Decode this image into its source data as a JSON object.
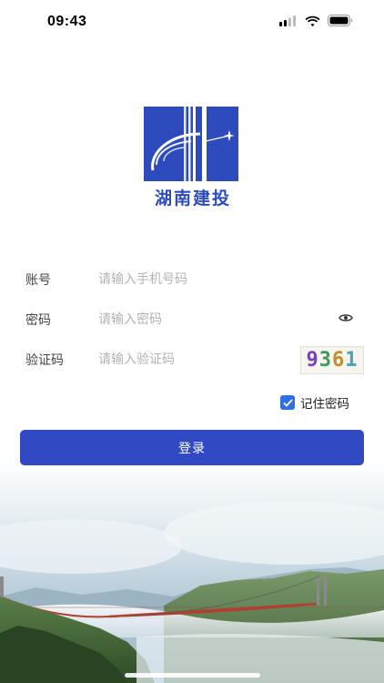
{
  "status_bar": {
    "time": "09:43"
  },
  "logo": {
    "company_name": "湖南建投"
  },
  "form": {
    "account": {
      "label": "账号",
      "placeholder": "请输入手机号码",
      "value": ""
    },
    "password": {
      "label": "密码",
      "placeholder": "请输入密码",
      "value": ""
    },
    "captcha": {
      "label": "验证码",
      "placeholder": "请输入验证码",
      "value": "",
      "captcha_digits": [
        "9",
        "3",
        "6",
        "1"
      ]
    },
    "remember": {
      "label": "记住密码",
      "checked": true
    }
  },
  "login_button": {
    "label": "登录"
  },
  "colors": {
    "primary": "#3249c4",
    "brand": "#2e4bbd",
    "checkbox": "#2f6fe6"
  }
}
